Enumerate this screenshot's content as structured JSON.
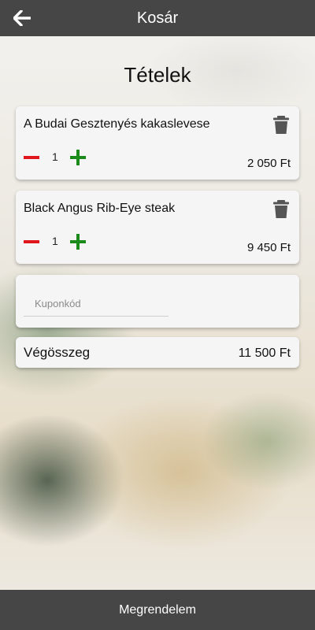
{
  "header": {
    "title": "Kosár",
    "back_icon": "arrow-left-icon"
  },
  "section_title": "Tételek",
  "items": [
    {
      "name": "A Budai Gesztenyés kakaslevese",
      "quantity": "1",
      "price": "2 050 Ft"
    },
    {
      "name": "Black Angus Rib-Eye steak",
      "quantity": "1",
      "price": "9 450 Ft"
    }
  ],
  "coupon": {
    "placeholder": "Kuponkód",
    "value": ""
  },
  "total": {
    "label": "Végösszeg",
    "value": "11 500 Ft"
  },
  "footer": {
    "order_label": "Megrendelem"
  },
  "colors": {
    "bar": "#464646",
    "minus": "#e0161c",
    "plus": "#1a8a1a",
    "card": "#f5f5f5"
  },
  "icons": {
    "delete": "trash-icon",
    "decrease": "minus-icon",
    "increase": "plus-icon"
  }
}
